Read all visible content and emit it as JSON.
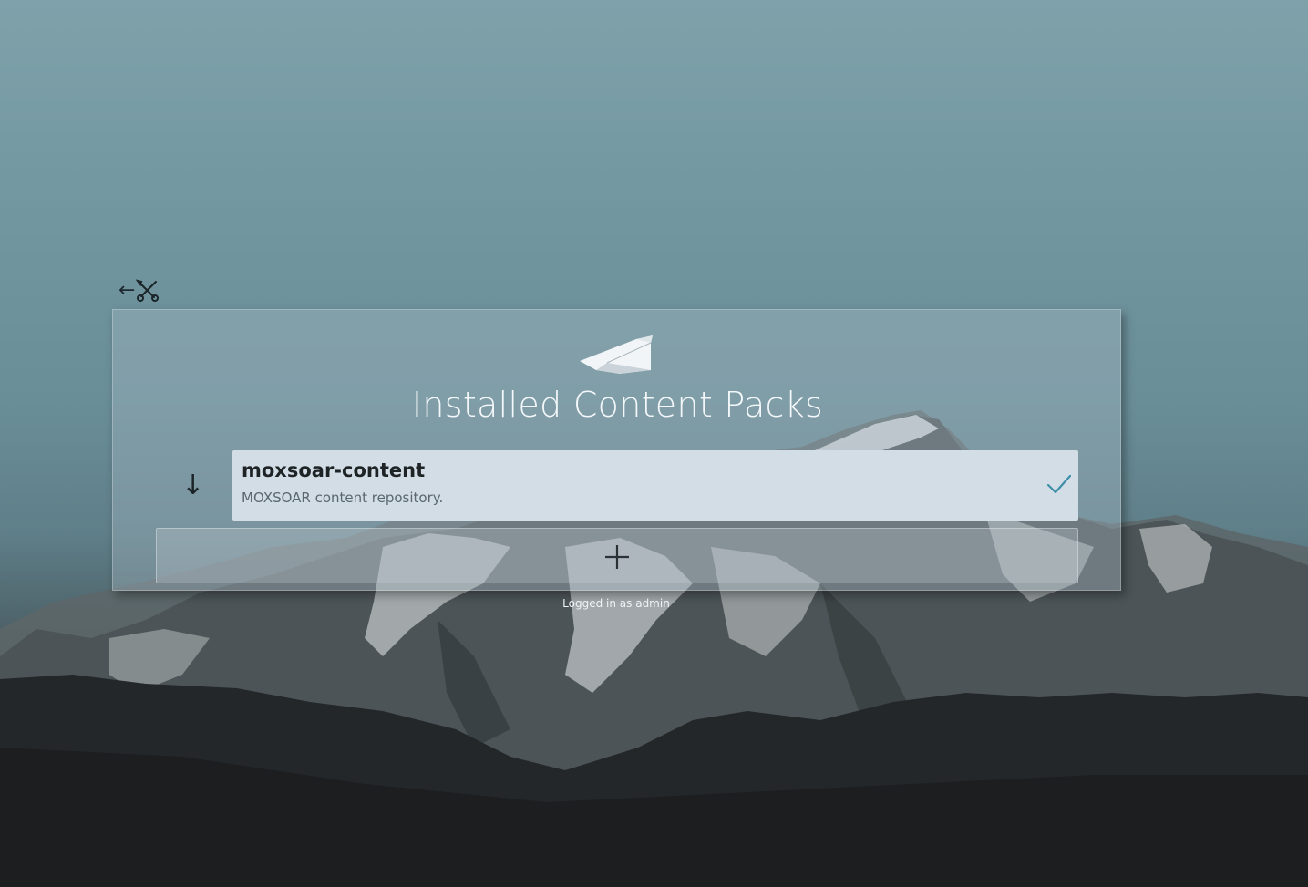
{
  "nav": {
    "back_icon": "left-arrow-icon",
    "tools_icon": "wrench-screwdriver-icon"
  },
  "panel": {
    "logo_icon": "paper-plane-icon",
    "title": "Installed Content Packs",
    "sort_icon": "down-arrow-icon",
    "packs": [
      {
        "name": "moxsoar-content",
        "description": "MOXSOAR content repository.",
        "status_icon": "checkmark-icon",
        "status_color": "#3f8fa8"
      }
    ],
    "add_icon": "plus-icon"
  },
  "footer": {
    "status": "Logged in as admin"
  }
}
